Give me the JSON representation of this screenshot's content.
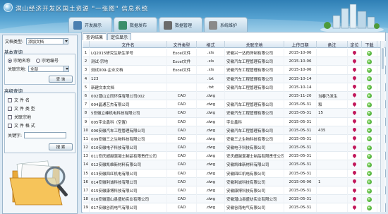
{
  "header": {
    "title": "潜山经济开发区国土资源 \"一张图\" 信息系统",
    "nav": [
      {
        "label": "开发展示",
        "color": "#4a7fb0"
      },
      {
        "label": "数据发布",
        "color": "#3a8e6b"
      },
      {
        "label": "数据管理",
        "color": "#6b6b6b"
      },
      {
        "label": "系统维护",
        "color": "#8a8a8a"
      }
    ]
  },
  "left": {
    "doc_type_label": "文档类型:",
    "doc_type_value": "添加文档",
    "basic_query_title": "基本查询",
    "radio_name": "宗地名称",
    "radio_code": "宗地编号",
    "assoc_label": "关联宗地:",
    "assoc_value": "全部",
    "query_btn": "查 询",
    "advanced_title": "高级查询",
    "checks": [
      "文 件 名",
      "文 件 类 型",
      "关联宗地",
      "文 件 格 式"
    ],
    "keyword_label": "关键字:",
    "search_btn": "搜 索"
  },
  "right": {
    "tabs": [
      "查询结果",
      "定位显示"
    ],
    "columns": [
      "",
      "文件名",
      "文件类型",
      "格式",
      "关联宗地",
      "上传日期",
      "备注",
      "定位",
      "下载"
    ],
    "rows": [
      {
        "n": "1",
        "name": "LQ2015研究生新生学号",
        "type": "Excel文件",
        "fmt": ".xls",
        "parcel": "安徽兴一达药饰制有限公司",
        "date": "2015-10-06",
        "note": ""
      },
      {
        "n": "2",
        "name": "测试-宗地",
        "type": "Excel文件",
        "fmt": ".xls",
        "parcel": "安徽汽车工程管理有限公司",
        "date": "2015-10-06",
        "note": ""
      },
      {
        "n": "3",
        "name": "测试009-企业文档",
        "type": "Excel文件",
        "fmt": ".xls",
        "parcel": "安徽汽车工程管理有限公司",
        "date": "2015-10-06",
        "note": ""
      },
      {
        "n": "4",
        "name": "123",
        "type": "",
        "fmt": ".txt",
        "parcel": "安徽汽车工程管理有限公司",
        "date": "2015-10-14",
        "note": ""
      },
      {
        "n": "5",
        "name": "新建文本文档",
        "type": "",
        "fmt": ".txt",
        "parcel": "安徽汽车工程管理有限公司",
        "date": "2015-10-14",
        "note": ""
      },
      {
        "n": "6",
        "name": "002潜山立同环保有限公司002",
        "type": "CAD",
        "fmt": ".dwg",
        "parcel": "",
        "date": "2015-11-20",
        "note": "当春乃发生"
      },
      {
        "n": "7",
        "name": "004晶通艺杰有限公司",
        "type": "CAD",
        "fmt": ".dwg",
        "parcel": "安徽汽车工程管理有限公司",
        "date": "2015-05-31",
        "note": "和"
      },
      {
        "n": "8",
        "name": "5安徽立峰机电科技有限公司",
        "type": "CAD",
        "fmt": ".dwg",
        "parcel": "安徽汽车工程管理有限公司",
        "date": "2015-05-31",
        "note": "15"
      },
      {
        "n": "9",
        "name": "005宇业鑫科（空置）",
        "type": "CAD",
        "fmt": ".dwg",
        "parcel": "宇业鑫科",
        "date": "2015-05-31",
        "note": ""
      },
      {
        "n": "10",
        "name": "006安徽汽车工程管理有限公司",
        "type": "CAD",
        "fmt": ".dwg",
        "parcel": "安徽汽车工程管理有限公司",
        "date": "2015-05-31",
        "note": "435"
      },
      {
        "n": "11",
        "name": "009安徽三之生物科技有限公司",
        "type": "CAD",
        "fmt": ".dwg",
        "parcel": "安徽三之生物科技有限公司",
        "date": "2015-05-31",
        "note": ""
      },
      {
        "n": "12",
        "name": "010安徽电子科技有限公司",
        "type": "CAD",
        "fmt": ".dwg",
        "parcel": "安徽电子科技有限公司",
        "date": "2015-05-31",
        "note": ""
      },
      {
        "n": "13",
        "name": "011安庆超越混凝土制品有限责任公司",
        "type": "CAD",
        "fmt": ".dwg",
        "parcel": "安庆超越混凝土制品有限责任公司",
        "date": "2015-05-31",
        "note": ""
      },
      {
        "n": "14",
        "name": "012安徽凯维新材料有限公司",
        "type": "CAD",
        "fmt": ".dwg",
        "parcel": "安徽凯维新材料有限公司",
        "date": "2015-05-31",
        "note": ""
      },
      {
        "n": "15",
        "name": "013安徽四红机电有限公司",
        "type": "CAD",
        "fmt": ".dwg",
        "parcel": "安徽四红机电有限公司",
        "date": "2015-05-31",
        "note": ""
      },
      {
        "n": "16",
        "name": "014安徽利诚科技有限公司",
        "type": "CAD",
        "fmt": ".dwg",
        "parcel": "安徽利诚科技有限公司",
        "date": "2015-06-06",
        "note": "1"
      },
      {
        "n": "17",
        "name": "015安徽康博科技有限公司",
        "type": "CAD",
        "fmt": ".dwg",
        "parcel": "安徽康博科技有限公司",
        "date": "2015-05-31",
        "note": ""
      },
      {
        "n": "18",
        "name": "016安徽潜山县盛纺实业有限公司",
        "type": "CAD",
        "fmt": ".dwg",
        "parcel": "安徽潜山县盛纺实业有限公司",
        "date": "2015-05-31",
        "note": ""
      },
      {
        "n": "19",
        "name": "017安徽谷雨电气有限公司",
        "type": "CAD",
        "fmt": ".dwg",
        "parcel": "安徽谷雨电气有限公司",
        "date": "2015-05-31",
        "note": ""
      }
    ]
  },
  "colors": {
    "accent": "#2f7fb5",
    "locate": "#c2185b",
    "download": "#2e9b1d"
  }
}
